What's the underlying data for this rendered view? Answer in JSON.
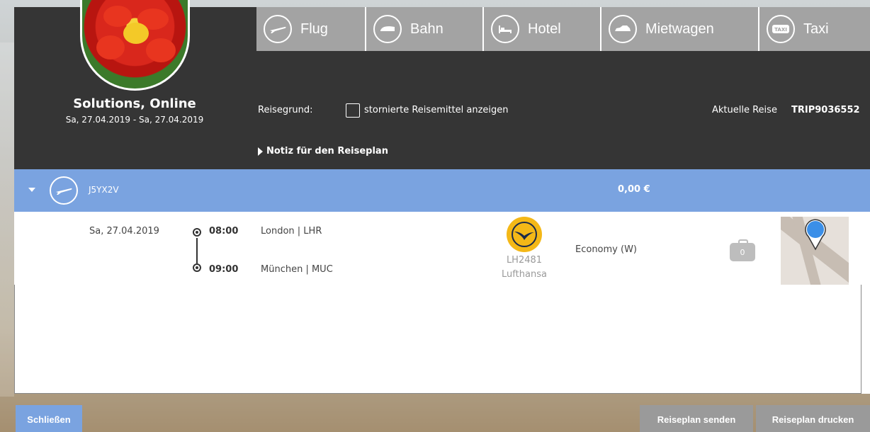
{
  "user": {
    "name": "Solutions, Online",
    "dates": "Sa, 27.04.2019 - Sa, 27.04.2019"
  },
  "tabs": [
    {
      "label": "Flug",
      "icon": "plane-icon"
    },
    {
      "label": "Bahn",
      "icon": "train-icon"
    },
    {
      "label": "Hotel",
      "icon": "bed-icon"
    },
    {
      "label": "Mietwagen",
      "icon": "car-icon"
    },
    {
      "label": "Taxi",
      "icon": "taxi-icon"
    }
  ],
  "filters": {
    "reason_label": "Reisegrund:",
    "show_cancelled_label": "stornierte Reisemittel anzeigen",
    "show_cancelled_checked": false
  },
  "current_trip": {
    "label": "Aktuelle Reise",
    "id": "TRIP9036552"
  },
  "note_toggle": "Notiz für den Reiseplan",
  "booking": {
    "code": "J5YX2V",
    "price": "0,00 €",
    "segment": {
      "date": "Sa,  27.04.2019",
      "departure_time": "08:00",
      "departure_airport": "London | LHR",
      "arrival_time": "09:00",
      "arrival_airport": "München | MUC",
      "flight_number": "LH2481",
      "airline": "Lufthansa",
      "cabin": "Economy (W)",
      "luggage_count": "0"
    }
  },
  "buttons": {
    "close": "Schließen",
    "send": "Reiseplan senden",
    "print": "Reiseplan drucken"
  },
  "colors": {
    "header_bg": "#353535",
    "tab_bg": "#a3a3a3",
    "accent_blue": "#7aa3e0",
    "airline_yellow": "#f4b817",
    "button_gray": "#9a9a9a"
  }
}
